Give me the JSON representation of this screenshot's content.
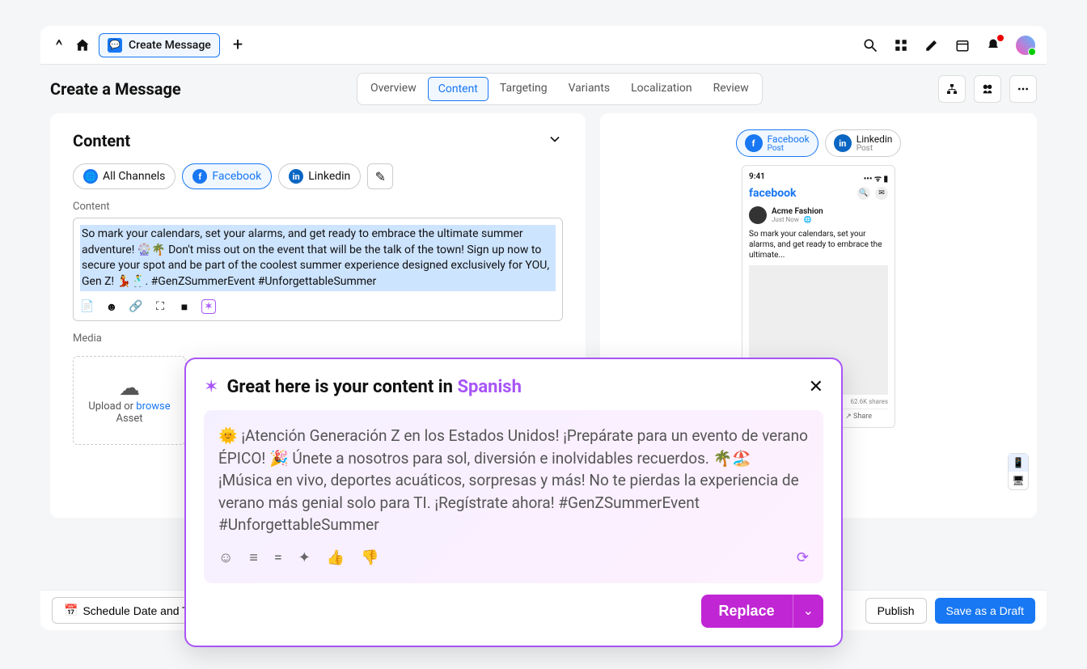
{
  "topbar": {
    "tab_label": "Create Message"
  },
  "page": {
    "title": "Create a Message"
  },
  "tabs": {
    "overview": "Overview",
    "content": "Content",
    "targeting": "Targeting",
    "variants": "Variants",
    "localization": "Localization",
    "review": "Review"
  },
  "content_panel": {
    "title": "Content",
    "channels": {
      "all": "All Channels",
      "facebook": "Facebook",
      "linkedin": "Linkedin"
    },
    "field_label": "Content",
    "text": "So mark your calendars, set your alarms, and get ready to embrace the ultimate summer adventure! 🎡🌴 Don't miss out on the event that will be the talk of the town! Sign up now to secure your spot and be part of the coolest summer experience designed exclusively for YOU, Gen Z! 💃🕺. #GenZSummerEvent #UnforgettableSummer",
    "media_label": "Media",
    "upload_text": "Upload or ",
    "browse_text": "browse",
    "asset_text": "Asset"
  },
  "preview": {
    "fb_tab": "Facebook",
    "fb_sub": "Post",
    "li_tab": "Linkedin",
    "li_sub": "Post",
    "time": "9:41",
    "brand": "facebook",
    "account": "Acme Fashion",
    "timestamp": "Just Now",
    "post_text": "So mark your calendars, set your alarms, and get ready to embrace the ultimate...",
    "shares": "62.6K shares",
    "share_label": "Share"
  },
  "footer": {
    "schedule": "Schedule Date and Ti",
    "publish": "Publish",
    "draft": "Save as a Draft"
  },
  "ai": {
    "title_prefix": "Great here is your content in ",
    "language": "Spanish",
    "content": "🌞 ¡Atención Generación Z en los Estados Unidos! ¡Prepárate para un evento de verano ÉPICO! 🎉 Únete a nosotros para sol, diversión e inolvidables recuerdos. 🌴🏖️ ¡Música en vivo, deportes acuáticos, sorpresas y más! No te pierdas la experiencia de verano más genial solo para TI. ¡Regístrate ahora! #GenZSummerEvent #UnforgettableSummer",
    "replace": "Replace"
  }
}
